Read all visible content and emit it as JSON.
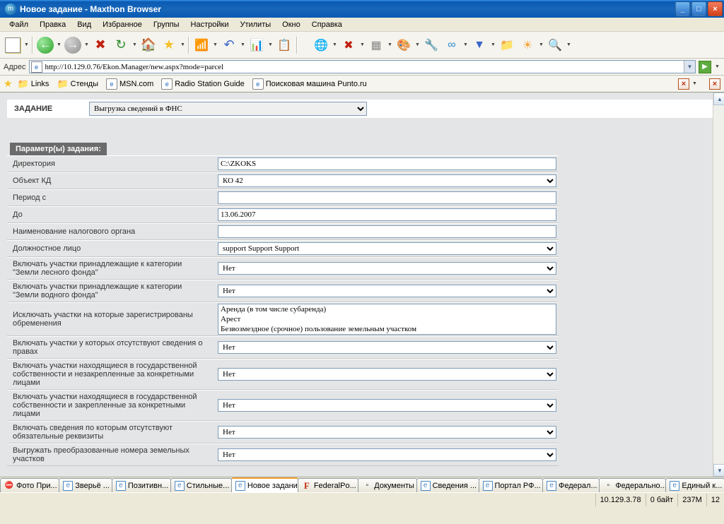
{
  "window": {
    "title": "Новое задание - Maxthon Browser"
  },
  "menu": [
    "Файл",
    "Правка",
    "Вид",
    "Избранное",
    "Группы",
    "Настройки",
    "Утилиты",
    "Окно",
    "Справка"
  ],
  "address": {
    "label": "Адрес",
    "url": "http://10.129.0.76/Ekon.Manager/new.aspx?mode=parcel"
  },
  "links": [
    "Links",
    "Стенды",
    "MSN.com",
    "Radio Station Guide",
    "Поисковая машина Punto.ru"
  ],
  "page": {
    "task_label": "ЗАДАНИЕ",
    "task_value": "Выгрузка сведений в ФНС",
    "params_header": "Параметр(ы) задания:",
    "rows": [
      {
        "label": "Директория",
        "type": "text",
        "value": "C:\\ZKOKS"
      },
      {
        "label": "Объект КД",
        "type": "select",
        "value": "КО 42"
      },
      {
        "label": "Период с",
        "type": "text",
        "value": ""
      },
      {
        "label": "До",
        "type": "text",
        "value": "13.06.2007"
      },
      {
        "label": "Наименование налогового органа",
        "type": "text",
        "value": ""
      },
      {
        "label": "Должностное лицо",
        "type": "select",
        "value": "support Support Support"
      },
      {
        "label": "Включать участки принадлежащие к категории \"Земли лесного фонда\"",
        "type": "select",
        "value": "Нет"
      },
      {
        "label": "Включать участки принадлежащие к категории \"Земли водного фонда\"",
        "type": "select",
        "value": "Нет"
      },
      {
        "label": "Исключать участки на которые зарегистрированы обременения",
        "type": "list",
        "options": [
          "Аренда (в том числе субаренда)",
          "Арест",
          "Безвозмездное (срочное) пользование земельным участком"
        ]
      },
      {
        "label": "Включать участки у которых отсутствуют сведения о правах",
        "type": "select",
        "value": "Нет"
      },
      {
        "label": "Включать участки находящиеся в государственной собственности и незакрепленные за конкретными лицами",
        "type": "select",
        "value": "Нет"
      },
      {
        "label": "Включать участки находящиеся в государственной собственности и закрепленные за конкретными лицами",
        "type": "select",
        "value": "Нет"
      },
      {
        "label": "Включать сведения по которым отсутствуют обязательные реквизиты",
        "type": "select",
        "value": "Нет"
      },
      {
        "label": "Выгружать преобразованные номера земельных участков",
        "type": "select",
        "value": "Нет"
      }
    ]
  },
  "tabs": [
    {
      "icon": "stop",
      "label": "Фото При..."
    },
    {
      "icon": "ie",
      "label": "Зверьё ..."
    },
    {
      "icon": "ie",
      "label": "Позитивн..."
    },
    {
      "icon": "ie",
      "label": "Стильные..."
    },
    {
      "icon": "ie",
      "label": "Новое задание",
      "active": true
    },
    {
      "icon": "F",
      "label": "FederalPo..."
    },
    {
      "icon": "none",
      "label": "Документы"
    },
    {
      "icon": "ie",
      "label": "Сведения ..."
    },
    {
      "icon": "ie",
      "label": "Портал РФ..."
    },
    {
      "icon": "ie",
      "label": "Федерал..."
    },
    {
      "icon": "none",
      "label": "Федерально..."
    },
    {
      "icon": "ie",
      "label": "Единый к..."
    }
  ],
  "status": {
    "ip": "10.129.3.78",
    "bytes": "0 байт",
    "mem": "237M",
    "count": "12"
  }
}
